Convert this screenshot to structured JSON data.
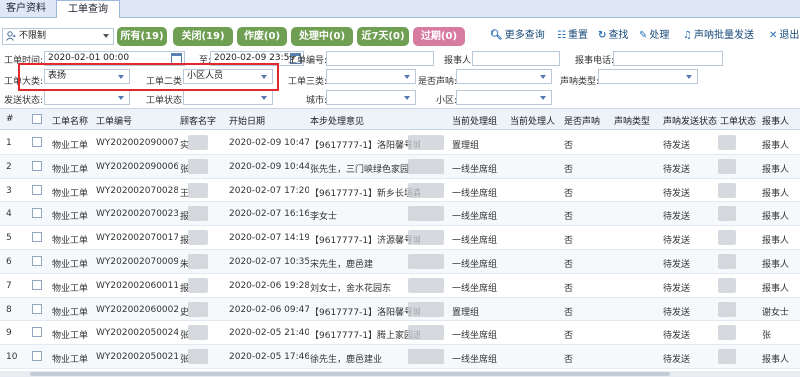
{
  "tabs": [
    {
      "label": "客户资料"
    },
    {
      "label": "工单查询"
    }
  ],
  "toolbar": {
    "user_select": "不限制",
    "filters": [
      {
        "label": "所有(19)",
        "color": "#6f9f53"
      },
      {
        "label": "关闭(19)",
        "color": "#6f9f53"
      },
      {
        "label": "作废(0)",
        "color": "#6f9f53"
      },
      {
        "label": "处理中(0)",
        "color": "#6f9f53"
      },
      {
        "label": "近7天(0)",
        "color": "#6f9f53"
      },
      {
        "label": "过期(0)",
        "color": "#d77ba0"
      }
    ],
    "actions": [
      {
        "icon": "search-more-icon",
        "label": "更多查询"
      },
      {
        "icon": "reset-icon",
        "label": "重置"
      },
      {
        "icon": "refresh-icon",
        "label": "查找"
      },
      {
        "icon": "edit-icon",
        "label": "处理"
      },
      {
        "icon": "speaker-icon",
        "label": "声呐批量发送"
      },
      {
        "icon": "close-icon",
        "label": "退出"
      }
    ]
  },
  "form": {
    "created_label": "工单时间:",
    "created_from": "2020-02-01 00:00",
    "to_label": "至:",
    "created_to": "2020-02-09 23:59",
    "order_no_label": "工单编号:",
    "order_no_value": "",
    "reporter_label": "报事人:",
    "reporter_value": "",
    "phone_label": "报事电话:",
    "phone_value": "",
    "cat1_label": "工单大类:",
    "cat1_value": "表扬",
    "cat2_label": "工单二类:",
    "cat2_value": "小区人员",
    "cat3_label": "工单三类:",
    "cat3_value": "",
    "sonar_label": "是否声呐:",
    "sonar_value": "",
    "sonar_type_label": "声呐类型:",
    "sonar_type_value": "",
    "send_status_label": "发送状态:",
    "send_status_value": "",
    "order_status_label": "工单状态:",
    "order_status_value": "",
    "city_label": "城市:",
    "city_value": "",
    "community_label": "小区:",
    "community_value": ""
  },
  "table": {
    "headers": [
      "#",
      "",
      "工单名称",
      "工单编号",
      "顾客名字",
      "开始日期",
      "本步处理意见",
      "当前处理组",
      "当前处理人",
      "是否声呐",
      "声呐类型",
      "声呐发送状态",
      "工单状态",
      "报事人"
    ],
    "rows": [
      {
        "num": "1",
        "name": "物业工单",
        "no": "WY202002090007",
        "cust": "实",
        "date": "2020-02-09 10:47",
        "opinion": "【9617777-1】洛阳馨号城",
        "group": "置理组",
        "sonar": "否",
        "send": "待发送",
        "status": "",
        "reporter": "报事人"
      },
      {
        "num": "2",
        "name": "物业工单",
        "no": "WY202002090006",
        "cust": "张",
        "date": "2020-02-09 10:44",
        "opinion": "张先生，三门峡绿色家园",
        "group": "一线坐席组",
        "sonar": "否",
        "send": "待发送",
        "status": "",
        "reporter": "报事人"
      },
      {
        "num": "3",
        "name": "物业工单",
        "no": "WY202002070028",
        "cust": "王",
        "date": "2020-02-07 17:20",
        "opinion": "【9617777-1】新乡长垣森林半",
        "group": "一线坐席组",
        "sonar": "否",
        "send": "待发送",
        "status": "",
        "reporter": "报事人"
      },
      {
        "num": "4",
        "name": "物业工单",
        "no": "WY202002070023",
        "cust": "报",
        "date": "2020-02-07 16:16",
        "opinion": "李女士",
        "group": "一线坐席组",
        "sonar": "否",
        "send": "待发送",
        "status": "",
        "reporter": "报事人"
      },
      {
        "num": "5",
        "name": "物业工单",
        "no": "WY202002070017",
        "cust": "报",
        "date": "2020-02-07 14:19",
        "opinion": "【9617777-1】济源馨号城",
        "group": "一线坐席组",
        "sonar": "否",
        "send": "待发送",
        "status": "",
        "reporter": "报事人"
      },
      {
        "num": "6",
        "name": "物业工单",
        "no": "WY202002070009",
        "cust": "朱",
        "date": "2020-02-07 10:35",
        "opinion": "宋先生，鹿邑建",
        "group": "一线坐席组",
        "sonar": "否",
        "send": "待发送",
        "status": "",
        "reporter": "报事人"
      },
      {
        "num": "7",
        "name": "物业工单",
        "no": "WY202002060011",
        "cust": "报",
        "date": "2020-02-06 19:28",
        "opinion": "刘女士，舍水花园东",
        "group": "一线坐席组",
        "sonar": "否",
        "send": "待发送",
        "status": "",
        "reporter": "报事人"
      },
      {
        "num": "8",
        "name": "物业工单",
        "no": "WY202002060002",
        "cust": "史",
        "date": "2020-02-06 09:47",
        "opinion": "【9617777-1】洛阳馨号城",
        "group": "置理组",
        "sonar": "否",
        "send": "待发送",
        "status": "",
        "reporter": "谢女士"
      },
      {
        "num": "9",
        "name": "物业工单",
        "no": "WY202002050024",
        "cust": "张",
        "date": "2020-02-05 21:40",
        "opinion": "【9617777-1】腾上家园进丁",
        "group": "一线坐席组",
        "sonar": "否",
        "send": "待发送",
        "status": "",
        "reporter": "张"
      },
      {
        "num": "10",
        "name": "物业工单",
        "no": "WY202002050021",
        "cust": "张",
        "date": "2020-02-05 17:46",
        "opinion": "徐先生，鹿邑建业",
        "group": "一线坐席组",
        "sonar": "否",
        "send": "待发送",
        "status": "",
        "reporter": "报事人"
      }
    ]
  }
}
